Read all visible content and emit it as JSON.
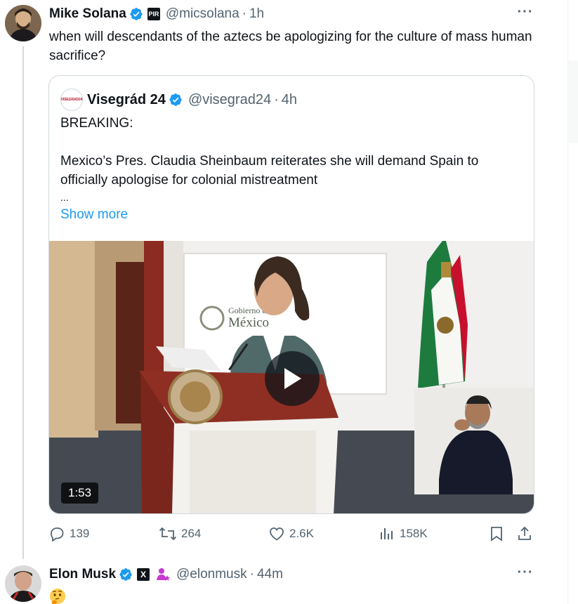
{
  "main_tweet": {
    "name": "Mike Solana",
    "org_badge": "PIR",
    "handle": "@micsolana",
    "separator": "·",
    "time": "1h",
    "text": "when will descendants of the aztecs be apologizing for the culture of mass human sacrifice?",
    "more_label": "···",
    "quote": {
      "avatar_text": "VISEGRAD24",
      "name": "Visegrád 24",
      "handle": "@visegrad24",
      "separator": "·",
      "time": "4h",
      "line1": "BREAKING:",
      "line2": "Mexico’s Pres. Claudia Sheinbaum reiterates she will demand Spain to officially apologise for colonial mistreatment",
      "ellipsis": "...",
      "show_more": "Show more",
      "video": {
        "duration": "1:53",
        "backdrop_text_line1": "Gobierno de",
        "backdrop_text_line2": "México"
      }
    },
    "actions": {
      "replies": "139",
      "reposts": "264",
      "likes": "2.6K",
      "views": "158K"
    }
  },
  "reply_tweet": {
    "name": "Elon Musk",
    "handle": "@elonmusk",
    "separator": "·",
    "time": "44m",
    "more_label": "···",
    "emoji": "thinking-face-icon"
  },
  "colors": {
    "link": "#1d9bf0",
    "verified": "#1d9bf0",
    "secondary_text": "#536471",
    "border": "#cfd9de"
  }
}
